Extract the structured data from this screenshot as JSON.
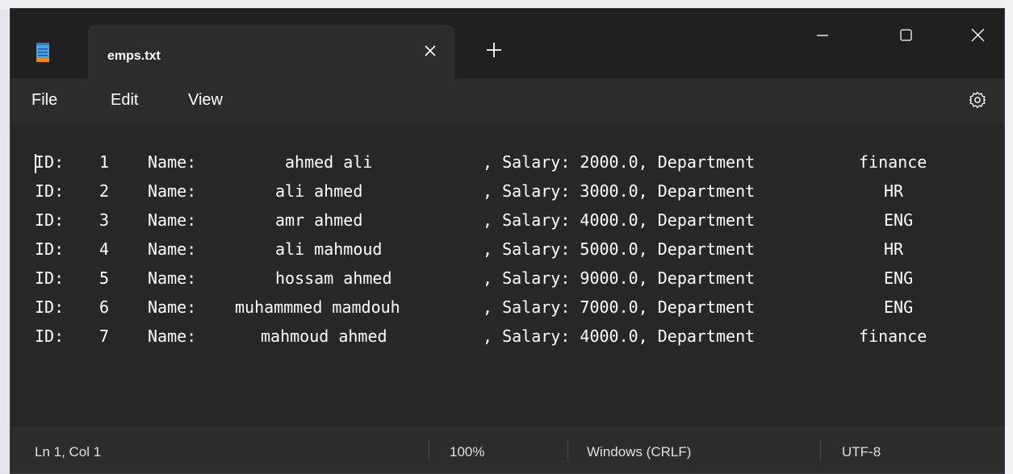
{
  "window": {
    "tab_title": "emps.txt",
    "new_tab_symbol": "+"
  },
  "menu": {
    "file": "File",
    "edit": "Edit",
    "view": "View"
  },
  "editor": {
    "lines": [
      {
        "id_label": "ID:",
        "id": "1",
        "name_label": "Name:",
        "name": "ahmed ali",
        "salary_text": ", Salary: 2000.0, Department",
        "dept": "finance"
      },
      {
        "id_label": "ID:",
        "id": "2",
        "name_label": "Name:",
        "name": "ali ahmed",
        "salary_text": ", Salary: 3000.0, Department",
        "dept": "HR"
      },
      {
        "id_label": "ID:",
        "id": "3",
        "name_label": "Name:",
        "name": "amr ahmed",
        "salary_text": ", Salary: 4000.0, Department",
        "dept": "ENG"
      },
      {
        "id_label": "ID:",
        "id": "4",
        "name_label": "Name:",
        "name": "ali mahmoud",
        "salary_text": ", Salary: 5000.0, Department",
        "dept": "HR"
      },
      {
        "id_label": "ID:",
        "id": "5",
        "name_label": "Name:",
        "name": "hossam ahmed",
        "salary_text": ", Salary: 9000.0, Department",
        "dept": "ENG"
      },
      {
        "id_label": "ID:",
        "id": "6",
        "name_label": "Name:",
        "name": "muhammmed mamdouh",
        "salary_text": ", Salary: 7000.0, Department",
        "dept": "ENG"
      },
      {
        "id_label": "ID:",
        "id": "7",
        "name_label": "Name:",
        "name": "mahmoud ahmed",
        "salary_text": ", Salary: 4000.0, Department",
        "dept": "finance"
      }
    ]
  },
  "status": {
    "position": "Ln 1, Col 1",
    "zoom": "100%",
    "line_ending": "Windows (CRLF)",
    "encoding": "UTF-8"
  },
  "colors": {
    "window_bg": "#202020",
    "bar_bg": "#2c2c2c",
    "editor_bg": "#272727",
    "notepad_icon_blue": "#4aa3e8"
  },
  "icons": [
    "notepad-icon",
    "close-tab-icon",
    "add-tab-icon",
    "minimize-icon",
    "maximize-icon",
    "close-window-icon",
    "settings-gear-icon"
  ]
}
